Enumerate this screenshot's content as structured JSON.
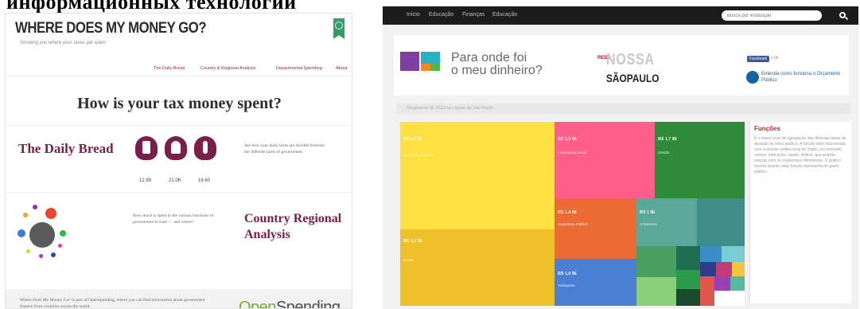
{
  "heading": "информационных технологий",
  "left": {
    "logo": "WHERE DOES MY MONEY GO?",
    "logo_sub": "Showing you where your taxes get spent",
    "nav": [
      "The Daily Bread",
      "Country & Regional Analysis",
      "Departmental Spending",
      "About"
    ],
    "title": "How is your tax money spent?",
    "daily_bread_title": "The Daily Bread",
    "bread_values": [
      "12.99",
      "21.06",
      "16.60"
    ],
    "daily_text": "See how your daily taxes are divided between the different parts of government.",
    "country_text": "How much is spent in the various functions of government in total — and where?",
    "country_title_1": "Country Regional",
    "country_title_2": "Analysis",
    "footer_text": "Where Does My Money Go? is part of OpenSpending, where you can find information about government finance from countries across the world.",
    "openspending_open": "Open",
    "openspending_spending": "Spending",
    "colors": {
      "accent": "#7a1e4c",
      "open": "#7aa83a"
    },
    "dot_colors": [
      "#e8472a",
      "#9b2dbb",
      "#f4a21c",
      "#5a5a5a",
      "#3b7dd8",
      "#2fb84f",
      "#ee3b8c",
      "#2e40c7",
      "#f0d21e",
      "#c02ad5"
    ]
  },
  "right": {
    "nav": [
      "Início",
      "Educação",
      "Finanças",
      "Educação"
    ],
    "search_placeholder": "Busca por instituição",
    "title_line1": "Para onde foi",
    "title_line2": "o meu dinheiro?",
    "rede": "REDE",
    "nossa": "NOSSA",
    "saopaulo": "SÃOPAULO",
    "fb_label": "Facebook",
    "fb_count": "1.9k",
    "oq_text": "Entenda como funciona o Orçamento Público",
    "crumb": "Orçamento de 2012 na cidade de São Paulo",
    "treemap": [
      {
        "value": "R$ 4,7 Bi",
        "sub": "Educação e cultura",
        "color": "#ffe042"
      },
      {
        "value": "R$ 3,1 Bi",
        "sub": "Saúde",
        "color": "#ffd63a"
      },
      {
        "value": "R$ 2,5 Bi",
        "sub": "Previdência social",
        "color": "#ff5e8a"
      },
      {
        "value": "R$ 1,7 Bi",
        "sub": "Gestão",
        "color": "#2e8b3a"
      },
      {
        "value": "R$ 1,4 Bi",
        "sub": "Segurança Pública",
        "color": "#ec6b35"
      },
      {
        "value": "R$ 1 Bi",
        "sub": "Urbanismo",
        "color": "#5aa89a"
      },
      {
        "value": "R$ 1,0 Bi",
        "sub": "Transporte",
        "color": "#4a7fd4"
      }
    ],
    "side_title": "Funções",
    "side_text": "É o maior nível de agregação das diversas áreas de atuação do setor público. A função está relacionada com a missão institucional do órgão, por exemplo, cultura, educação, saúde, defesa, que guarda relação com os respectivos Ministérios. O gráfico mostra quanto cada função representa do gasto público."
  }
}
